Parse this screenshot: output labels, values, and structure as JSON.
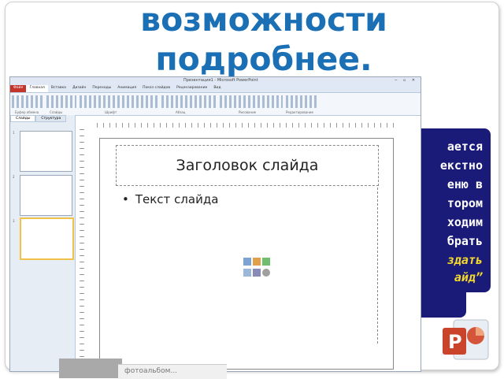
{
  "heading": {
    "line1": "возможности",
    "line2": "подробнее."
  },
  "app": {
    "title": "Презентация1 - Microsoft PowerPoint",
    "window_controls": "─ ▫ ✕",
    "tabs": [
      "Файл",
      "Главная",
      "Вставка",
      "Дизайн",
      "Переходы",
      "Анимация",
      "Показ слайдов",
      "Рецензирование",
      "Вид"
    ],
    "ribbon_groups": [
      "Буфер обмена",
      "Слайды",
      "Шрифт",
      "Абзац",
      "Рисование",
      "Редактирование"
    ],
    "panel_tabs": [
      "Слайды",
      "Структура"
    ],
    "slide_numbers": [
      "1",
      "2",
      "3"
    ]
  },
  "slide": {
    "title": "Заголовок слайда",
    "bullet": "Текст слайда"
  },
  "callout": {
    "lines": [
      "ается",
      "екстно",
      "еню в",
      "тором",
      "ходим",
      "брать"
    ],
    "highlight": [
      "здать",
      "айд”"
    ]
  },
  "footer_text": "фотоальбом...",
  "colors": {
    "heading": "#1a6fb5",
    "callout_bg": "#1a1a78",
    "callout_highlight": "#f5d92a",
    "file_tab": "#c4342a"
  }
}
